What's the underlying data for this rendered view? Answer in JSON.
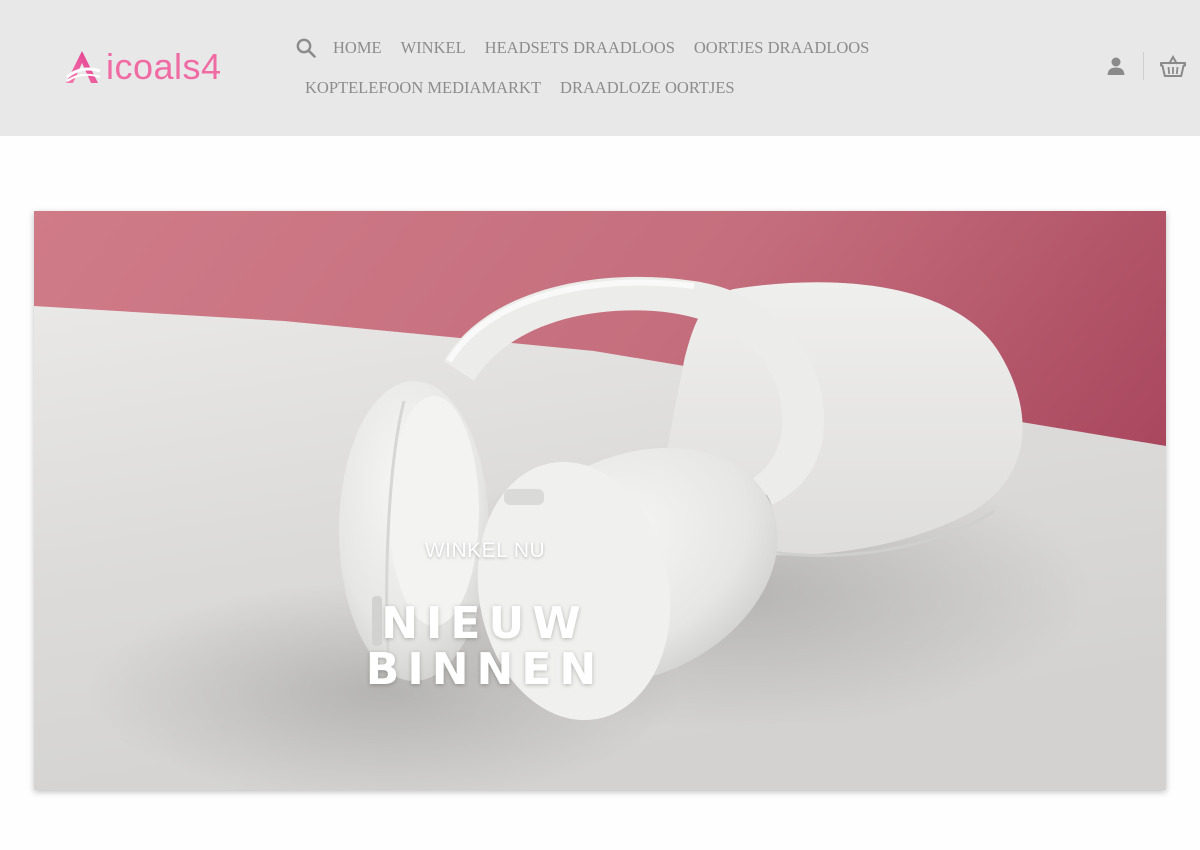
{
  "brand": {
    "logo_text": "icoals4",
    "color": "#f06aa4"
  },
  "nav": {
    "search_icon": "search-icon",
    "row1": [
      "HOME",
      "WINKEL",
      "HEADSETS DRAADLOOS",
      "OORTJES DRAADLOOS"
    ],
    "row2": [
      "KOPTELEFOON MEDIAMARKT",
      "DRAADLOZE OORTJES"
    ]
  },
  "header_icons": {
    "account": "user-icon",
    "cart": "basket-icon"
  },
  "hero": {
    "kicker": "WINKEL NU",
    "title_line1": "NIEUW",
    "title_line2": "BINNEN",
    "background_color": "#c96f7e"
  }
}
